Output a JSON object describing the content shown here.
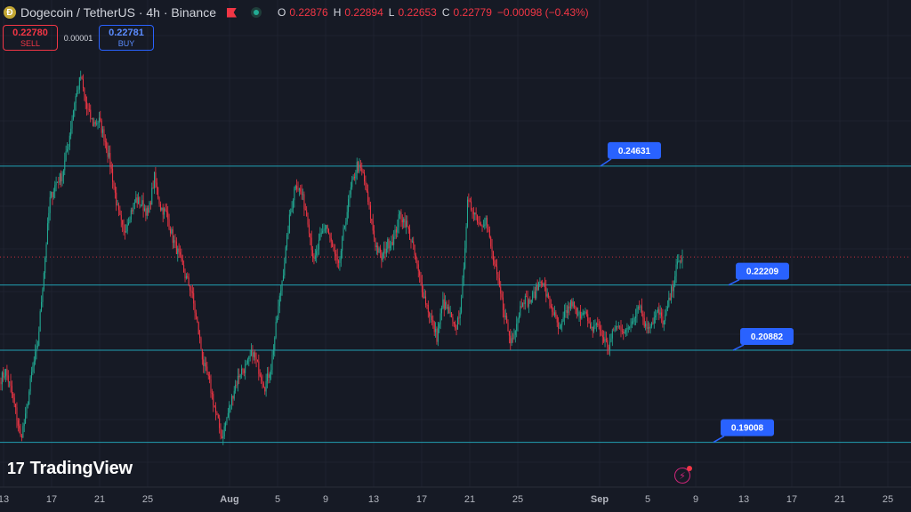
{
  "header": {
    "symbol": "Dogecoin / TetherUS · 4h · Binance",
    "ohlc": [
      {
        "key": "O",
        "value": "0.22876"
      },
      {
        "key": "H",
        "value": "0.22894"
      },
      {
        "key": "L",
        "value": "0.22653"
      },
      {
        "key": "C",
        "value": "0.22779"
      },
      {
        "key": "",
        "value": "−0.00098 (−0.43%)"
      }
    ]
  },
  "trade": {
    "sell_price": "0.22780",
    "sell_label": "SELL",
    "spread": "0.00001",
    "buy_price": "0.22781",
    "buy_label": "BUY"
  },
  "brand": {
    "logo_text": "TradingView"
  },
  "colors": {
    "background": "#161a25",
    "up": "#22ab94",
    "down": "#f23645",
    "level_line": "#21a0b3",
    "callout": "#2962ff"
  },
  "chart_data": {
    "type": "candlestick",
    "title": "Dogecoin / TetherUS · 4h · Binance",
    "ylim": [
      0.1815,
      0.2765
    ],
    "grid": true,
    "x_ticks": [
      "13",
      "17",
      "21",
      "25",
      "Aug",
      "5",
      "9",
      "13",
      "17",
      "21",
      "25",
      "Sep",
      "5",
      "9",
      "13",
      "17",
      "21",
      "25"
    ],
    "last_price": 0.22779,
    "levels": [
      {
        "label": "0.24631",
        "value": 0.24631
      },
      {
        "label": "0.22209",
        "value": 0.22209
      },
      {
        "label": "0.20882",
        "value": 0.20882
      },
      {
        "label": "0.19008",
        "value": 0.19008
      }
    ],
    "anchors": [
      [
        0,
        0.203
      ],
      [
        4,
        0.2045
      ],
      [
        8,
        0.201
      ],
      [
        12,
        0.1965
      ],
      [
        16,
        0.191
      ],
      [
        20,
        0.195
      ],
      [
        25,
        0.204
      ],
      [
        30,
        0.21
      ],
      [
        35,
        0.225
      ],
      [
        40,
        0.2395
      ],
      [
        45,
        0.243
      ],
      [
        50,
        0.2445
      ],
      [
        55,
        0.251
      ],
      [
        60,
        0.2595
      ],
      [
        65,
        0.2645
      ],
      [
        70,
        0.258
      ],
      [
        75,
        0.255
      ],
      [
        80,
        0.2555
      ],
      [
        85,
        0.2515
      ],
      [
        90,
        0.2455
      ],
      [
        95,
        0.2375
      ],
      [
        100,
        0.2325
      ],
      [
        105,
        0.2365
      ],
      [
        110,
        0.2395
      ],
      [
        115,
        0.2385
      ],
      [
        120,
        0.2365
      ],
      [
        125,
        0.244
      ],
      [
        130,
        0.238
      ],
      [
        135,
        0.2365
      ],
      [
        140,
        0.2315
      ],
      [
        145,
        0.228
      ],
      [
        150,
        0.224
      ],
      [
        155,
        0.221
      ],
      [
        160,
        0.214
      ],
      [
        165,
        0.206
      ],
      [
        170,
        0.202
      ],
      [
        175,
        0.196
      ],
      [
        180,
        0.191
      ],
      [
        185,
        0.196
      ],
      [
        190,
        0.201
      ],
      [
        195,
        0.2045
      ],
      [
        200,
        0.2055
      ],
      [
        205,
        0.2085
      ],
      [
        210,
        0.205
      ],
      [
        215,
        0.2015
      ],
      [
        220,
        0.2055
      ],
      [
        225,
        0.2155
      ],
      [
        230,
        0.225
      ],
      [
        235,
        0.2355
      ],
      [
        240,
        0.243
      ],
      [
        245,
        0.2405
      ],
      [
        250,
        0.2355
      ],
      [
        255,
        0.2265
      ],
      [
        260,
        0.2315
      ],
      [
        265,
        0.2345
      ],
      [
        270,
        0.2295
      ],
      [
        275,
        0.2255
      ],
      [
        280,
        0.2345
      ],
      [
        285,
        0.2415
      ],
      [
        290,
        0.2465
      ],
      [
        295,
        0.2445
      ],
      [
        300,
        0.2375
      ],
      [
        305,
        0.2305
      ],
      [
        310,
        0.2275
      ],
      [
        315,
        0.2305
      ],
      [
        320,
        0.2315
      ],
      [
        325,
        0.2365
      ],
      [
        330,
        0.2345
      ],
      [
        335,
        0.2305
      ],
      [
        340,
        0.2245
      ],
      [
        345,
        0.2195
      ],
      [
        350,
        0.2155
      ],
      [
        355,
        0.2115
      ],
      [
        360,
        0.2185
      ],
      [
        365,
        0.2165
      ],
      [
        370,
        0.2125
      ],
      [
        375,
        0.2185
      ],
      [
        380,
        0.2385
      ],
      [
        385,
        0.2375
      ],
      [
        390,
        0.2345
      ],
      [
        395,
        0.2355
      ],
      [
        400,
        0.2285
      ],
      [
        405,
        0.2225
      ],
      [
        410,
        0.2165
      ],
      [
        415,
        0.2105
      ],
      [
        420,
        0.2145
      ],
      [
        425,
        0.2195
      ],
      [
        430,
        0.2185
      ],
      [
        435,
        0.2205
      ],
      [
        440,
        0.2235
      ],
      [
        445,
        0.2195
      ],
      [
        450,
        0.2165
      ],
      [
        455,
        0.2125
      ],
      [
        460,
        0.2165
      ],
      [
        465,
        0.2185
      ],
      [
        470,
        0.2155
      ],
      [
        475,
        0.2175
      ],
      [
        480,
        0.2125
      ],
      [
        485,
        0.2145
      ],
      [
        490,
        0.2115
      ],
      [
        495,
        0.2095
      ],
      [
        500,
        0.2135
      ],
      [
        505,
        0.2135
      ],
      [
        510,
        0.2125
      ],
      [
        515,
        0.2155
      ],
      [
        520,
        0.2185
      ],
      [
        525,
        0.2135
      ],
      [
        530,
        0.2145
      ],
      [
        535,
        0.2165
      ],
      [
        540,
        0.2145
      ],
      [
        545,
        0.2195
      ],
      [
        550,
        0.2255
      ],
      [
        555,
        0.2279
      ]
    ]
  }
}
